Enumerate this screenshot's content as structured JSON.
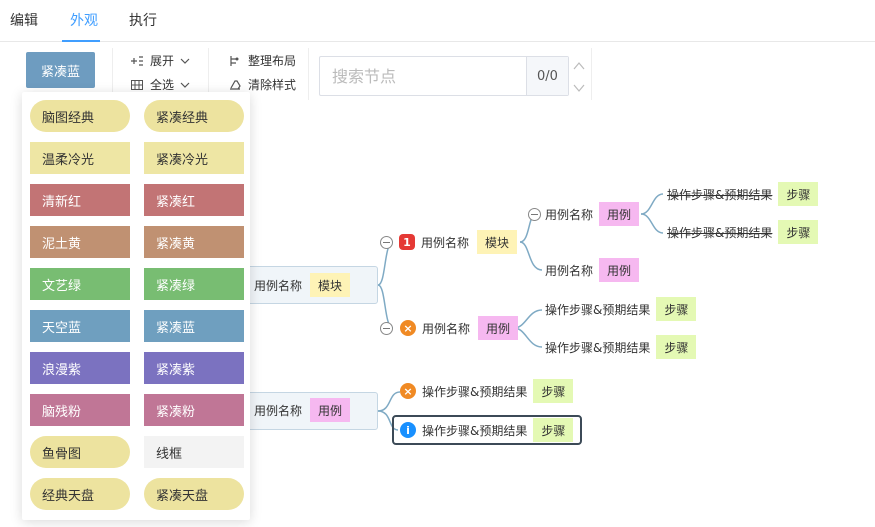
{
  "tabs": [
    "编辑",
    "外观",
    "执行"
  ],
  "toolbar": {
    "theme_button": "紧凑蓝",
    "expand": "展开",
    "select_all": "全选",
    "arrange": "整理布局",
    "clear_style": "清除样式",
    "search_placeholder": "搜索节点",
    "search_count": "0/0"
  },
  "themes": [
    {
      "label": "脑图经典",
      "bg": "#ede39f",
      "fg": "#333333",
      "pill": true
    },
    {
      "label": "紧凑经典",
      "bg": "#ede39f",
      "fg": "#333333",
      "pill": true
    },
    {
      "label": "温柔冷光",
      "bg": "#eee6a4",
      "fg": "#333333",
      "pill": false
    },
    {
      "label": "紧凑冷光",
      "bg": "#eee6a4",
      "fg": "#333333",
      "pill": false
    },
    {
      "label": "清新红",
      "bg": "#c27475",
      "fg": "#ffffff",
      "pill": false
    },
    {
      "label": "紧凑红",
      "bg": "#c27475",
      "fg": "#ffffff",
      "pill": false
    },
    {
      "label": "泥土黄",
      "bg": "#c09172",
      "fg": "#ffffff",
      "pill": false
    },
    {
      "label": "紧凑黄",
      "bg": "#c09172",
      "fg": "#ffffff",
      "pill": false
    },
    {
      "label": "文艺绿",
      "bg": "#78bd72",
      "fg": "#ffffff",
      "pill": false
    },
    {
      "label": "紧凑绿",
      "bg": "#78bd72",
      "fg": "#ffffff",
      "pill": false
    },
    {
      "label": "天空蓝",
      "bg": "#6f9fbf",
      "fg": "#ffffff",
      "pill": false
    },
    {
      "label": "紧凑蓝",
      "bg": "#6f9fbf",
      "fg": "#ffffff",
      "pill": false
    },
    {
      "label": "浪漫紫",
      "bg": "#7b72c0",
      "fg": "#ffffff",
      "pill": false
    },
    {
      "label": "紧凑紫",
      "bg": "#7b72c0",
      "fg": "#ffffff",
      "pill": false
    },
    {
      "label": "脑残粉",
      "bg": "#c07696",
      "fg": "#ffffff",
      "pill": false
    },
    {
      "label": "紧凑粉",
      "bg": "#c07696",
      "fg": "#ffffff",
      "pill": false
    },
    {
      "label": "鱼骨图",
      "bg": "#ede39f",
      "fg": "#333333",
      "pill": true
    },
    {
      "label": "线框",
      "bg": "#f3f3f3",
      "fg": "#333333",
      "pill": false
    },
    {
      "label": "经典天盘",
      "bg": "#ede39f",
      "fg": "#333333",
      "pill": true
    },
    {
      "label": "紧凑天盘",
      "bg": "#ede39f",
      "fg": "#333333",
      "pill": true
    }
  ],
  "mindmap": {
    "root1": {
      "text": "用例名称",
      "tag": "模块"
    },
    "root2": {
      "text": "用例名称",
      "tag": "用例"
    },
    "n_a": {
      "text": "用例名称",
      "tag": "模块",
      "badge": "1"
    },
    "n_b": {
      "text": "用例名称",
      "tag": "用例",
      "badge": "×"
    },
    "n_a1": {
      "text": "用例名称",
      "tag": "用例"
    },
    "n_a2": {
      "text": "用例名称",
      "tag": "用例"
    },
    "n_a1_1": {
      "text": "操作步骤&预期结果",
      "tag": "步骤"
    },
    "n_a1_2": {
      "text": "操作步骤&预期结果",
      "tag": "步骤"
    },
    "n_b1": {
      "text": "操作步骤&预期结果",
      "tag": "步骤"
    },
    "n_b2": {
      "text": "操作步骤&预期结果",
      "tag": "步骤"
    },
    "n_c1": {
      "text": "操作步骤&预期结果",
      "tag": "步骤",
      "badge": "×"
    },
    "n_c2": {
      "text": "操作步骤&预期结果",
      "tag": "步骤",
      "badge": "i"
    }
  },
  "colors": {
    "accent": "#409eff",
    "line": "#7faac4",
    "badge_red": "#e53935",
    "badge_orange": "#f08a24",
    "badge_blue": "#1890ff",
    "selected_border": "#3c4a57"
  }
}
